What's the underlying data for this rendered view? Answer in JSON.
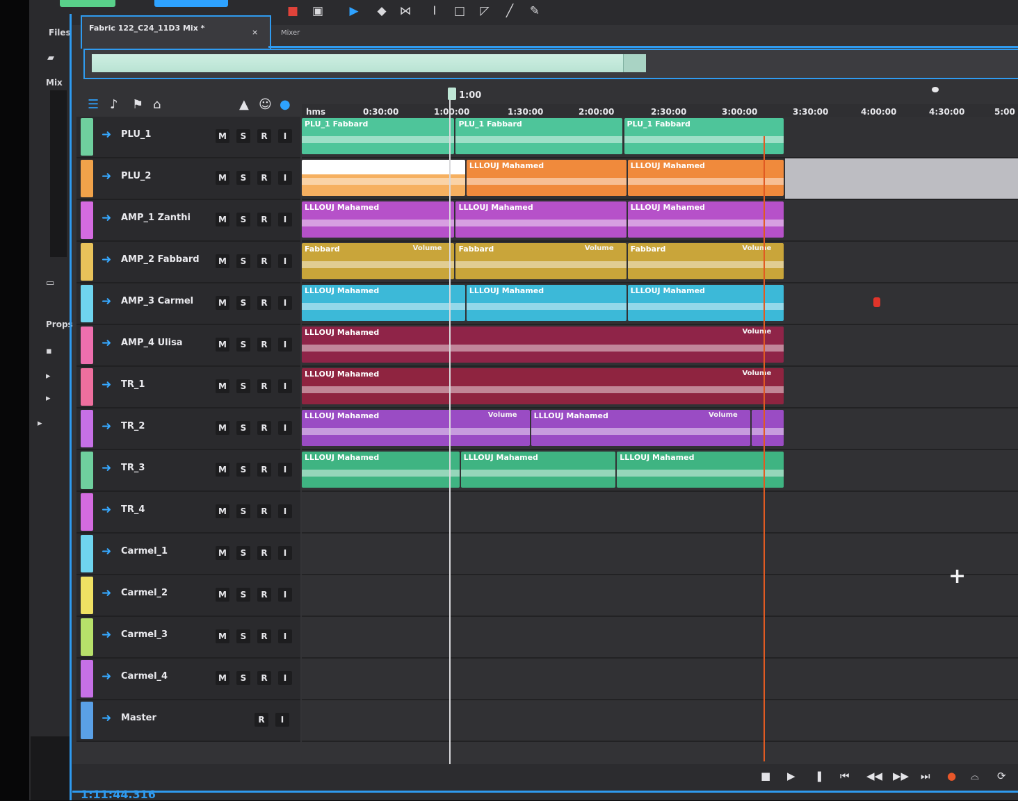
{
  "toolbar": {
    "tabs": [
      "",
      ""
    ],
    "tools": [
      {
        "icon": "record-icon",
        "glyph": "■"
      },
      {
        "icon": "window-icon",
        "glyph": "▣"
      },
      {
        "icon": "selection-tool-icon",
        "glyph": "▶"
      },
      {
        "icon": "eraser-tool-icon",
        "glyph": "◆"
      },
      {
        "icon": "split-tool-icon",
        "glyph": "⋈"
      },
      {
        "icon": "text-cursor-icon",
        "glyph": "I"
      },
      {
        "icon": "marquee-tool-icon",
        "glyph": "□"
      },
      {
        "icon": "fade-tool-icon",
        "glyph": "◸"
      },
      {
        "icon": "line-tool-icon",
        "glyph": "╱"
      },
      {
        "icon": "pencil-tool-icon",
        "glyph": "✎"
      }
    ]
  },
  "side_panel": {
    "items": [
      "Files",
      "Mix",
      "Props"
    ]
  },
  "sequence": {
    "tab_label": "Fabric 122_C24_11D3 Mix *",
    "close_glyph": "×",
    "second_tab": "Mixer"
  },
  "ruler": {
    "playhead_label": "1:00",
    "ticks": [
      "hms",
      "0:30:00",
      "1:00:00",
      "1:30:00",
      "2:00:00",
      "2:30:00",
      "3:00:00",
      "3:30:00",
      "4:00:00",
      "4:30:00",
      "5:00"
    ]
  },
  "tracks": [
    {
      "name": "PLU_1",
      "color": "#6fcf9e",
      "buttons": [
        "M",
        "S",
        "R",
        "I"
      ],
      "clips": [
        {
          "start": 0,
          "end": 0.215,
          "title": "PLU_1 Fabbard",
          "vol": ""
        },
        {
          "start": 0.215,
          "end": 0.45,
          "title": "PLU_1 Fabbard",
          "vol": ""
        },
        {
          "start": 0.45,
          "end": 0.675,
          "title": "PLU_1 Fabbard",
          "vol": ""
        }
      ],
      "clip_color": "#4ec59a"
    },
    {
      "name": "PLU_2",
      "color": "#f0a24a",
      "buttons": [
        "M",
        "S",
        "R",
        "I"
      ],
      "clips": [
        {
          "start": 0,
          "end": 0.23,
          "title": "",
          "vol": ""
        },
        {
          "start": 0.23,
          "end": 0.455,
          "title": "LLLOUJ Mahamed",
          "vol": ""
        },
        {
          "start": 0.455,
          "end": 0.675,
          "title": "LLLOUJ Mahamed",
          "vol": ""
        }
      ],
      "clip_color": "#f08a3c"
    },
    {
      "name": "AMP_1 Zanthi",
      "color": "#d46be0",
      "buttons": [
        "M",
        "S",
        "R",
        "I"
      ],
      "clips": [
        {
          "start": 0,
          "end": 0.215,
          "title": "LLLOUJ Mahamed",
          "vol": ""
        },
        {
          "start": 0.215,
          "end": 0.455,
          "title": "LLLOUJ Mahamed",
          "vol": ""
        },
        {
          "start": 0.455,
          "end": 0.675,
          "title": "LLLOUJ Mahamed",
          "vol": ""
        }
      ],
      "clip_color": "#b651c9"
    },
    {
      "name": "AMP_2 Fabbard",
      "color": "#e8c25a",
      "buttons": [
        "M",
        "S",
        "R",
        "I"
      ],
      "clips": [
        {
          "start": 0,
          "end": 0.215,
          "title": "Fabbard",
          "vol": "Volume"
        },
        {
          "start": 0.215,
          "end": 0.455,
          "title": "Fabbard",
          "vol": "Volume"
        },
        {
          "start": 0.455,
          "end": 0.675,
          "title": "Fabbard",
          "vol": "Volume"
        }
      ],
      "clip_color": "#c9a53a"
    },
    {
      "name": "AMP_3 Carmel",
      "color": "#6fd4ee",
      "buttons": [
        "M",
        "S",
        "R",
        "I"
      ],
      "clips": [
        {
          "start": 0,
          "end": 0.23,
          "title": "LLLOUJ Mahamed",
          "vol": ""
        },
        {
          "start": 0.23,
          "end": 0.455,
          "title": "LLLOUJ Mahamed",
          "vol": ""
        },
        {
          "start": 0.455,
          "end": 0.675,
          "title": "LLLOUJ Mahamed",
          "vol": ""
        }
      ],
      "clip_color": "#3cb9d8"
    },
    {
      "name": "AMP_4 Ulisa",
      "color": "#ee6fae",
      "buttons": [
        "M",
        "S",
        "R",
        "I"
      ],
      "clips": [
        {
          "start": 0,
          "end": 0.675,
          "title": "LLLOUJ Mahamed",
          "vol": "Volume"
        }
      ],
      "clip_color": "#8f2448"
    },
    {
      "name": "TR_1",
      "color": "#ee6f9e",
      "buttons": [
        "M",
        "S",
        "R",
        "I"
      ],
      "clips": [
        {
          "start": 0,
          "end": 0.675,
          "title": "LLLOUJ Mahamed",
          "vol": "Volume"
        }
      ],
      "clip_color": "#8f2440"
    },
    {
      "name": "TR_2",
      "color": "#c670e6",
      "buttons": [
        "M",
        "S",
        "R",
        "I"
      ],
      "clips": [
        {
          "start": 0,
          "end": 0.32,
          "title": "LLLOUJ Mahamed",
          "vol": "Volume"
        },
        {
          "start": 0.32,
          "end": 0.628,
          "title": "LLLOUJ Mahamed",
          "vol": "Volume"
        },
        {
          "start": 0.628,
          "end": 0.675,
          "title": "",
          "vol": ""
        }
      ],
      "clip_color": "#9a4cc4"
    },
    {
      "name": "TR_3",
      "color": "#6fcf9e",
      "buttons": [
        "M",
        "S",
        "R",
        "I"
      ],
      "clips": [
        {
          "start": 0,
          "end": 0.222,
          "title": "LLLOUJ Mahamed",
          "vol": ""
        },
        {
          "start": 0.222,
          "end": 0.44,
          "title": "LLLOUJ Mahamed",
          "vol": ""
        },
        {
          "start": 0.44,
          "end": 0.675,
          "title": "LLLOUJ Mahamed",
          "vol": ""
        }
      ],
      "clip_color": "#3fb482"
    },
    {
      "name": "TR_4",
      "color": "#d46be0",
      "buttons": [
        "M",
        "S",
        "R",
        "I"
      ],
      "clips": [],
      "clip_color": ""
    },
    {
      "name": "Carmel_1",
      "color": "#6fd4ee",
      "buttons": [
        "M",
        "S",
        "R",
        "I"
      ],
      "clips": [],
      "clip_color": ""
    },
    {
      "name": "Carmel_2",
      "color": "#efe063",
      "buttons": [
        "M",
        "S",
        "R",
        "I"
      ],
      "clips": [],
      "clip_color": ""
    },
    {
      "name": "Carmel_3",
      "color": "#b7e06a",
      "buttons": [
        "M",
        "S",
        "R",
        "I"
      ],
      "clips": [],
      "clip_color": ""
    },
    {
      "name": "Carmel_4",
      "color": "#c670e6",
      "buttons": [
        "M",
        "S",
        "R",
        "I"
      ],
      "clips": [],
      "clip_color": ""
    },
    {
      "name": "Master",
      "color": "#5aa0e6",
      "buttons": [
        "R",
        "I"
      ],
      "clips": [],
      "clip_color": ""
    }
  ],
  "transport": {
    "timecode": "1:11:44.316",
    "buttons": [
      {
        "icon": "stop-icon",
        "glyph": "■"
      },
      {
        "icon": "play-icon",
        "glyph": "▶"
      },
      {
        "icon": "pause-icon",
        "glyph": "❚"
      },
      {
        "icon": "go-to-start-icon",
        "glyph": "⏮"
      },
      {
        "icon": "rewind-icon",
        "glyph": "◀◀"
      },
      {
        "icon": "fast-forward-icon",
        "glyph": "▶▶"
      },
      {
        "icon": "go-to-end-icon",
        "glyph": "⏭"
      },
      {
        "icon": "record-icon",
        "glyph": "●"
      },
      {
        "icon": "loop-icon",
        "glyph": "⌓"
      },
      {
        "icon": "skip-icon",
        "glyph": "⟳"
      }
    ]
  },
  "colors": {
    "accent": "#2f9bf0",
    "playhead": "#d9d9dc",
    "end_marker": "#e05a22"
  }
}
